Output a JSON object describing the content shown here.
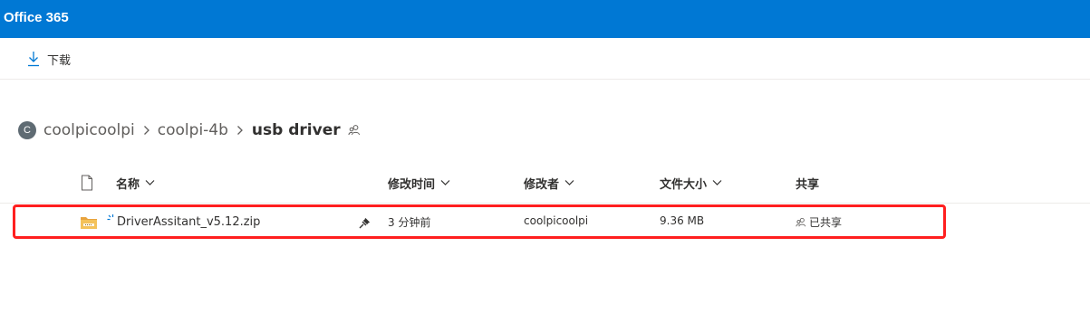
{
  "app": {
    "title": "Office 365",
    "brand_color": "#0078d4"
  },
  "commandbar": {
    "download_label": "下载",
    "download_icon": "download-arrow-icon"
  },
  "breadcrumb": {
    "site_initial": "C",
    "items": [
      "coolpicoolpi",
      "coolpi-4b"
    ],
    "current": "usb driver"
  },
  "columns": {
    "name": "名称",
    "modified": "修改时间",
    "modified_by": "修改者",
    "size": "文件大小",
    "sharing": "共享"
  },
  "files": [
    {
      "name": "DriverAssitant_v5.12.zip",
      "modified": "3 分钟前",
      "modified_by": "coolpicoolpi",
      "size": "9.36 MB",
      "sharing": "已共享",
      "icon": "zip-folder-icon"
    }
  ],
  "highlight_color": "#ff1f1f"
}
